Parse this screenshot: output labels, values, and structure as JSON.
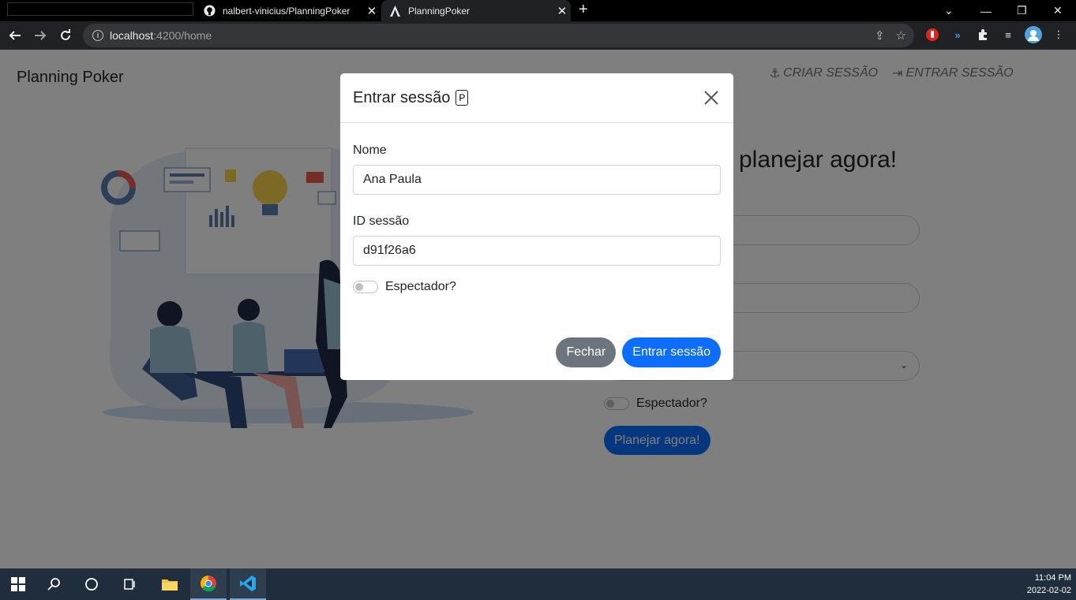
{
  "browser": {
    "tabs": [
      {
        "title": "nalbert-vinicius/PlanningPoker"
      },
      {
        "title": "PlanningPoker"
      }
    ],
    "url_host": "localhost",
    "url_rest": ":4200/home"
  },
  "page": {
    "brand": "Planning Poker",
    "nav": {
      "create": "CRIAR SESSÃO",
      "enter": "ENTRAR SESSÃO"
    },
    "hero_title": "planejar agora!",
    "spectator_label": "Espectador?",
    "cta_label": "Planejar agora!"
  },
  "modal": {
    "title": "Entrar sessão",
    "badge": "P",
    "name_label": "Nome",
    "name_value": "Ana Paula",
    "session_label": "ID sessão",
    "session_value": "d91f26a6",
    "spectator_label": "Espectador?",
    "close_label": "Fechar",
    "submit_label": "Entrar sessão"
  },
  "taskbar": {
    "time": "11:04 PM",
    "date": "2022-02-02"
  },
  "colors": {
    "primary": "#0d6efd",
    "secondary": "#6c757d",
    "chrome_bg": "#202124",
    "taskbar_bg": "#1f2d3c"
  }
}
